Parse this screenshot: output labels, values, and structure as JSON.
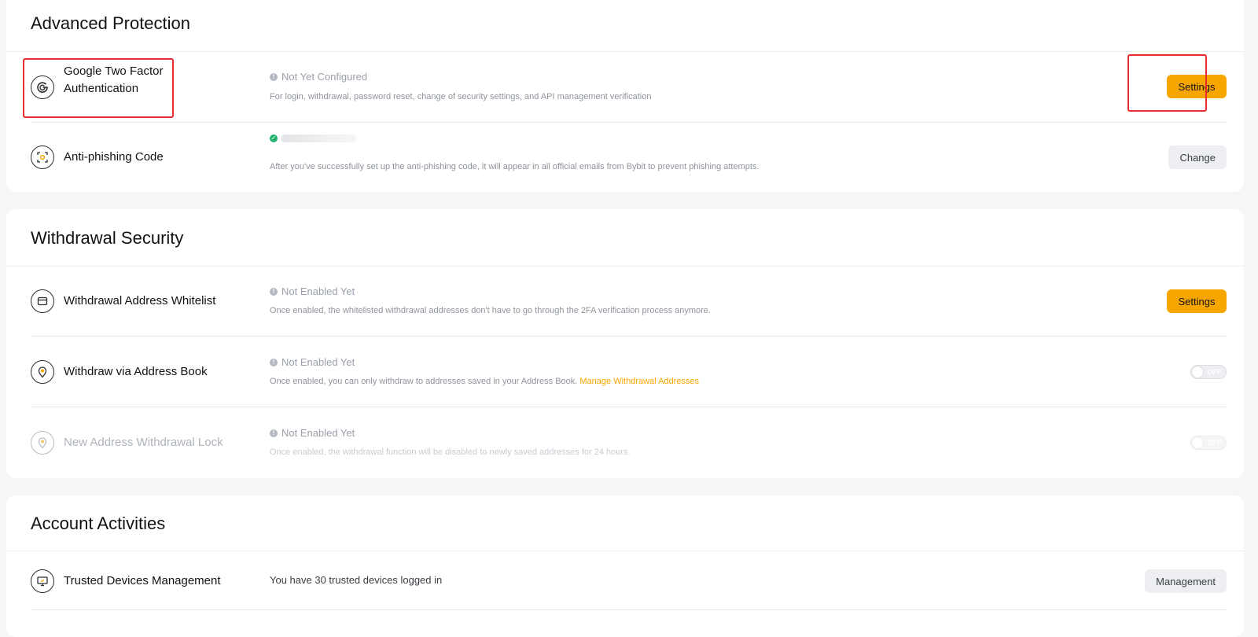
{
  "advanced_protection": {
    "title": "Advanced Protection",
    "google_2fa": {
      "label_line1": "Google Two Factor",
      "label_line2": "Authentication",
      "status": "Not Yet Configured",
      "description": "For login, withdrawal, password reset, change of security settings, and API management verification",
      "button": "Settings"
    },
    "anti_phishing": {
      "label": "Anti-phishing Code",
      "description": "After you've successfully set up the anti-phishing code, it will appear in all official emails from Bybit to prevent phishing attempts.",
      "button": "Change"
    }
  },
  "withdrawal_security": {
    "title": "Withdrawal Security",
    "whitelist": {
      "label": "Withdrawal Address Whitelist",
      "status": "Not Enabled Yet",
      "description": "Once enabled, the whitelisted withdrawal addresses don't have to go through the 2FA verification process anymore.",
      "button": "Settings"
    },
    "address_book": {
      "label": "Withdraw via Address Book",
      "status": "Not Enabled Yet",
      "description": "Once enabled, you can only withdraw to addresses saved in your Address Book.",
      "link": "Manage Withdrawal Addresses",
      "toggle": "OFF"
    },
    "new_address_lock": {
      "label": "New Address Withdrawal Lock",
      "status": "Not Enabled Yet",
      "description": "Once enabled, the withdrawal function will be disabled to newly saved addresses for 24 hours.",
      "toggle": "OFF"
    }
  },
  "account_activities": {
    "title": "Account Activities",
    "trusted_devices": {
      "label": "Trusted Devices Management",
      "description": "You have 30 trusted devices logged in",
      "button": "Management"
    }
  },
  "colors": {
    "accent": "#f7a600",
    "highlight": "#e52d2d",
    "success": "#20b26c",
    "background": "#f5f6f8"
  }
}
